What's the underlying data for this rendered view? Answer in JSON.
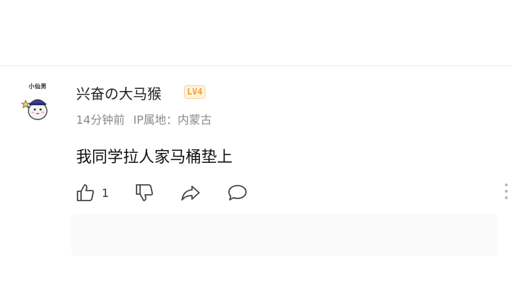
{
  "comment_item": {
    "avatar_text": "小仙男",
    "username": "兴奋の大马猴",
    "level": "LV4",
    "time_ago": "14分钟前",
    "ip_location": "IP属地：内蒙古",
    "comment_text": "我同学拉人家马桶垫上",
    "like_count": "1",
    "icons": {
      "like": "thumbs-up-icon",
      "dislike": "thumbs-down-icon",
      "share": "share-icon",
      "reply": "comment-bubble-icon",
      "more": "more-vertical-icon"
    },
    "colors": {
      "level_badge_text": "#f0a030",
      "level_badge_bg": "#fff3dc",
      "meta_text": "#8a8a8a"
    }
  }
}
